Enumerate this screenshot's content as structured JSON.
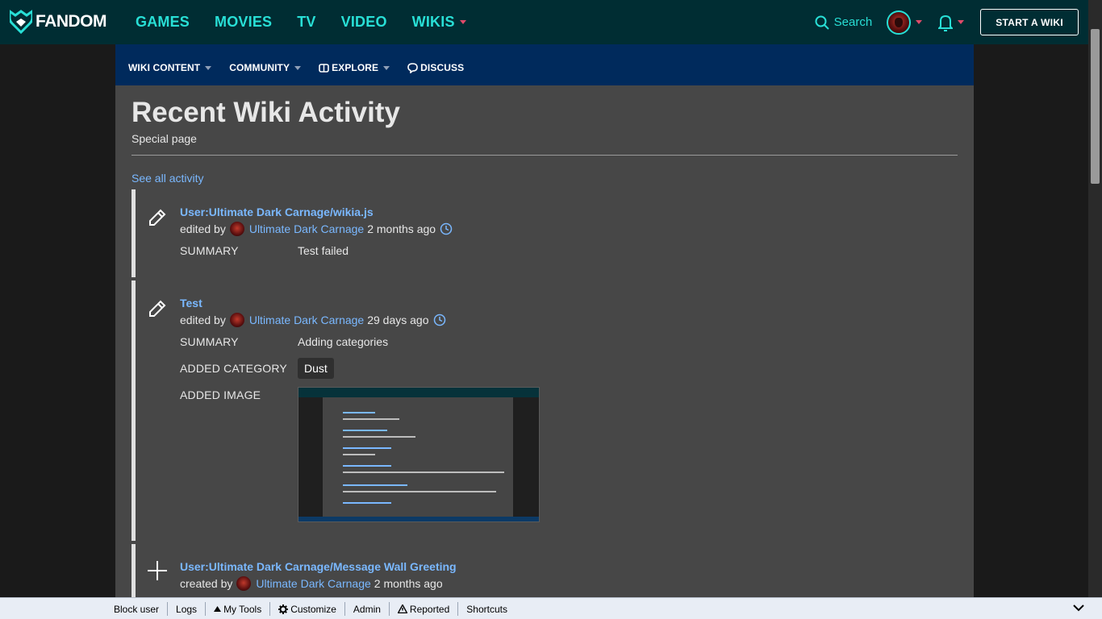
{
  "global_nav": {
    "logo_text": "FANDOM",
    "links": [
      {
        "label": "GAMES"
      },
      {
        "label": "MOVIES"
      },
      {
        "label": "TV"
      },
      {
        "label": "VIDEO"
      },
      {
        "label": "WIKIS"
      }
    ],
    "search_label": "Search",
    "start_wiki_label": "START A WIKI",
    "accent_color": "#28dfd6",
    "caret_color": "#e14a6a"
  },
  "community_nav": {
    "items": [
      {
        "label": "WIKI CONTENT",
        "icon": "",
        "has_caret": true
      },
      {
        "label": "COMMUNITY",
        "icon": "",
        "has_caret": true
      },
      {
        "label": "EXPLORE",
        "icon": "explore-icon",
        "has_caret": true
      },
      {
        "label": "DISCUSS",
        "icon": "discuss-icon",
        "has_caret": false
      }
    ],
    "background_color": "#002a5c"
  },
  "page": {
    "title": "Recent Wiki Activity",
    "subtitle": "Special page",
    "see_all": "See all activity",
    "link_color": "#7ab8ff"
  },
  "activity": [
    {
      "icon": "pencil-icon",
      "title": "User:Ultimate Dark Carnage/wikia.js",
      "action": "edited by",
      "user": "Ultimate Dark Carnage",
      "time": "2 months ago",
      "rows": [
        {
          "label": "SUMMARY",
          "value": "Test failed"
        }
      ]
    },
    {
      "icon": "pencil-icon",
      "title": "Test",
      "action": "edited by",
      "user": "Ultimate Dark Carnage",
      "time": "29 days ago",
      "rows": [
        {
          "label": "SUMMARY",
          "value": "Adding categories"
        },
        {
          "label": "ADDED CATEGORY",
          "value": "Dust"
        },
        {
          "label": "ADDED IMAGE",
          "value": ""
        }
      ]
    },
    {
      "icon": "plus-icon",
      "title": "User:Ultimate Dark Carnage/Message Wall Greeting",
      "action": "created by",
      "user": "Ultimate Dark Carnage",
      "time": "2 months ago",
      "rows": []
    }
  ],
  "toolbar": {
    "items": [
      {
        "label": "Block user",
        "icon": ""
      },
      {
        "label": "Logs",
        "icon": ""
      },
      {
        "label": "My Tools",
        "icon": "triangle-up-icon"
      },
      {
        "label": "Customize",
        "icon": "gear-icon"
      },
      {
        "label": "Admin",
        "icon": ""
      },
      {
        "label": "Reported",
        "icon": "warning-icon"
      },
      {
        "label": "Shortcuts",
        "icon": ""
      }
    ]
  }
}
